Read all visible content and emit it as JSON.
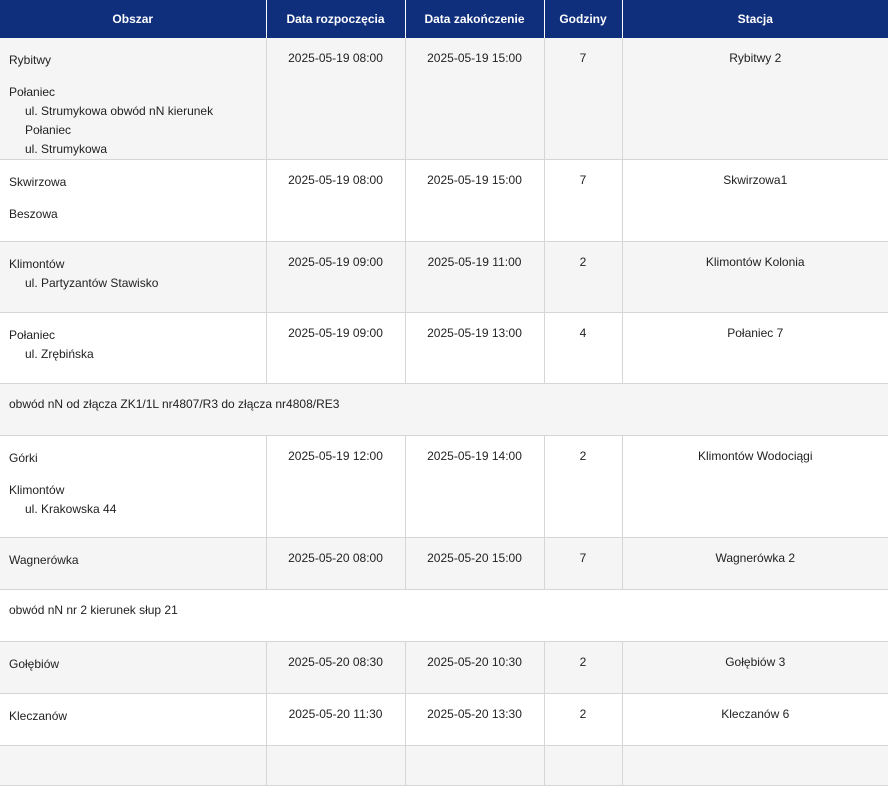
{
  "headers": [
    "Obszar",
    "Data rozpoczęcia",
    "Data zakończenie",
    "Godziny",
    "Stacja"
  ],
  "rows": [
    {
      "type": "data",
      "style": "odd",
      "height": 121,
      "areas": [
        {
          "name": "Rybitwy",
          "streets": []
        },
        {
          "name": "Połaniec",
          "streets": [
            "ul. Strumykowa obwód nN kierunek Połaniec",
            "ul. Strumykowa"
          ]
        }
      ],
      "start": "2025-05-19 08:00",
      "end": "2025-05-19 15:00",
      "hours": "7",
      "station": "Rybitwy 2"
    },
    {
      "type": "data",
      "style": "even",
      "height": 82,
      "areas": [
        {
          "name": "Skwirzowa",
          "streets": []
        },
        {
          "name": "Beszowa",
          "streets": []
        }
      ],
      "start": "2025-05-19 08:00",
      "end": "2025-05-19 15:00",
      "hours": "7",
      "station": "Skwirzowa1"
    },
    {
      "type": "data",
      "style": "odd",
      "height": 71,
      "areas": [
        {
          "name": "Klimontów",
          "streets": [
            "ul. Partyzantów Stawisko"
          ]
        }
      ],
      "start": "2025-05-19 09:00",
      "end": "2025-05-19 11:00",
      "hours": "2",
      "station": "Klimontów Kolonia"
    },
    {
      "type": "data",
      "style": "even",
      "height": 71,
      "areas": [
        {
          "name": "Połaniec",
          "streets": [
            "ul. Zrębińska"
          ]
        }
      ],
      "start": "2025-05-19 09:00",
      "end": "2025-05-19 13:00",
      "hours": "4",
      "station": "Połaniec 7"
    },
    {
      "type": "note",
      "style": "odd",
      "height": 38,
      "text": "obwód nN od złącza ZK1/1L nr4807/R3 do złącza nr4808/RE3"
    },
    {
      "type": "data",
      "style": "even",
      "height": 102,
      "areas": [
        {
          "name": "Górki",
          "streets": []
        },
        {
          "name": "Klimontów",
          "streets": [
            "ul. Krakowska 44"
          ]
        }
      ],
      "start": "2025-05-19 12:00",
      "end": "2025-05-19 14:00",
      "hours": "2",
      "station": "Klimontów Wodociągi"
    },
    {
      "type": "data",
      "style": "odd",
      "height": 52,
      "areas": [
        {
          "name": "Wagnerówka",
          "streets": []
        }
      ],
      "start": "2025-05-20 08:00",
      "end": "2025-05-20 15:00",
      "hours": "7",
      "station": "Wagnerówka 2"
    },
    {
      "type": "note",
      "style": "even",
      "height": 38,
      "text": "obwód nN nr 2 kierunek słup 21"
    },
    {
      "type": "data",
      "style": "odd",
      "height": 52,
      "areas": [
        {
          "name": "Gołębiów",
          "streets": []
        }
      ],
      "start": "2025-05-20 08:30",
      "end": "2025-05-20 10:30",
      "hours": "2",
      "station": "Gołębiów 3"
    },
    {
      "type": "data",
      "style": "even",
      "height": 52,
      "areas": [
        {
          "name": "Kleczanów",
          "streets": []
        }
      ],
      "start": "2025-05-20 11:30",
      "end": "2025-05-20 13:30",
      "hours": "2",
      "station": "Kleczanów 6"
    },
    {
      "type": "data",
      "style": "odd",
      "height": 40,
      "areas": [],
      "start": "",
      "end": "",
      "hours": "",
      "station": ""
    }
  ]
}
